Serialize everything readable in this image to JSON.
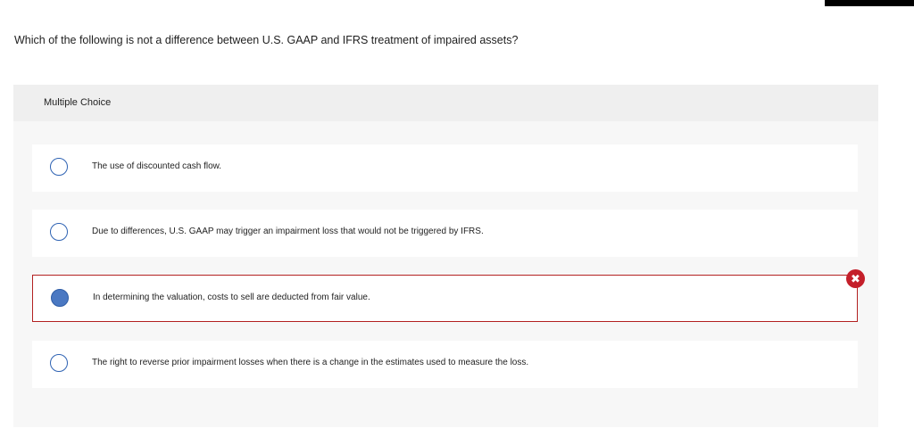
{
  "question": {
    "text": "Which of the following is not a difference between U.S. GAAP and IFRS treatment of impaired assets?"
  },
  "multiple_choice": {
    "header_label": "Multiple Choice",
    "options": [
      {
        "text": "The use of discounted cash flow.",
        "selected": false
      },
      {
        "text": "Due to differences, U.S. GAAP may trigger an impairment loss that would not be triggered by IFRS.",
        "selected": false
      },
      {
        "text": "In determining the valuation, costs to sell are deducted from fair value.",
        "selected": true,
        "marked_incorrect": true
      },
      {
        "text": "The right to reverse prior impairment losses when there is a change in the estimates used to measure the loss.",
        "selected": false
      }
    ]
  },
  "feedback": {
    "incorrect_icon": "x-circle-icon",
    "incorrect_glyph": "✖"
  },
  "colors": {
    "radio_border": "#2f63b3",
    "radio_selected_fill": "#4a78c2",
    "incorrect_red": "#c41f2a",
    "selected_border": "#b32121"
  }
}
